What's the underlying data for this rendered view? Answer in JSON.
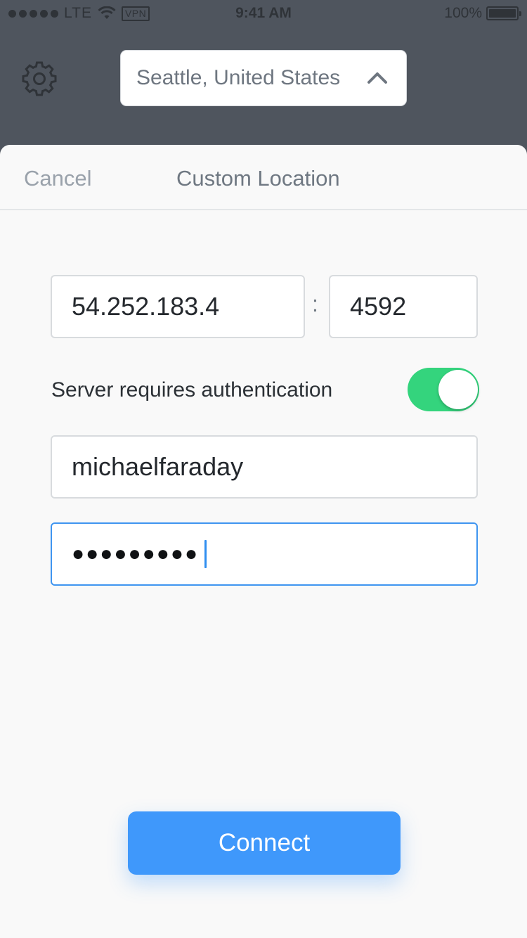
{
  "status_bar": {
    "carrier": "LTE",
    "vpn_badge": "VPN",
    "time": "9:41 AM",
    "battery": "100%",
    "signal_bars": 5
  },
  "header": {
    "location_selected": "Seattle, United States"
  },
  "sheet": {
    "cancel_label": "Cancel",
    "title": "Custom Location",
    "ip_address": "54.252.183.4",
    "separator": ":",
    "port": "4592",
    "auth_label": "Server requires authentication",
    "auth_enabled": true,
    "username": "michaelfaraday",
    "password_masked": "●●●●●●●●●",
    "connect_label": "Connect"
  },
  "colors": {
    "header_bg": "#4f555e",
    "accent": "#3f98fb",
    "toggle_on": "#34d47d",
    "focus_border": "#3f95f0"
  },
  "icons": {
    "settings": "gear-icon",
    "location_toggle": "chevron-up-icon",
    "wifi": "wifi-icon",
    "battery": "battery-icon"
  }
}
